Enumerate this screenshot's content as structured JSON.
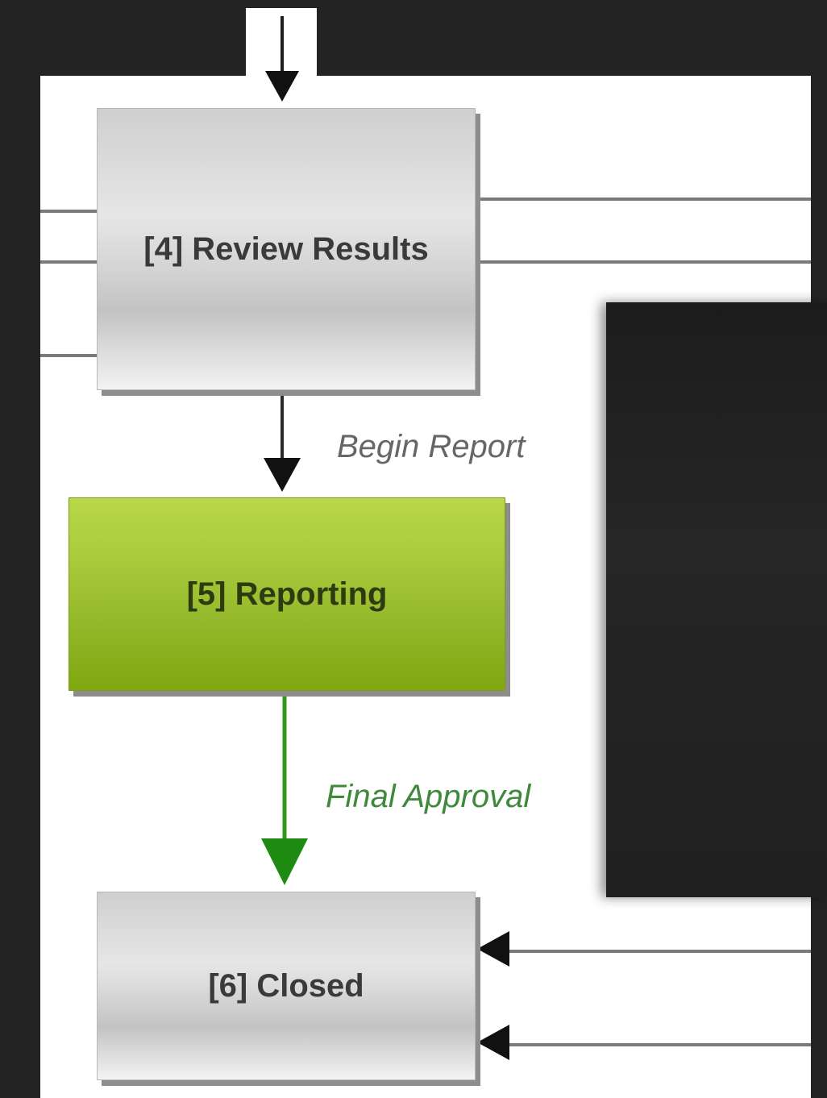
{
  "diagram": {
    "nodes": [
      {
        "id": "n4",
        "label": "[4] Review Results",
        "style": "gray"
      },
      {
        "id": "n5",
        "label": "[5] Reporting",
        "style": "green"
      },
      {
        "id": "n6",
        "label": "[6] Closed",
        "style": "gray"
      }
    ],
    "edges": [
      {
        "from": "n4",
        "to": "n5",
        "label": "Begin Report",
        "color": "#1e1e1e"
      },
      {
        "from": "n5",
        "to": "n6",
        "label": "Final Approval",
        "color": "#2f9a1a"
      }
    ]
  },
  "colors": {
    "background": "#232323",
    "panel": "#ffffff",
    "active_node": "#93b82a",
    "active_edge": "#2f9a1a",
    "line": "#7a7a7a"
  }
}
